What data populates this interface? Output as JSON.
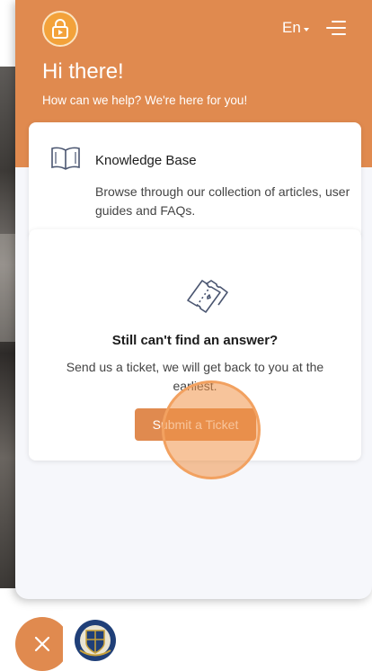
{
  "header": {
    "language": "En",
    "greeting": "Hi there!",
    "subtitle": "How can we help? We're here for you!"
  },
  "knowledge_base": {
    "title": "Knowledge Base",
    "description": "Browse through our collection of articles, user guides and FAQs.",
    "icon": "open-book-icon"
  },
  "ticket": {
    "title": "Still can't find an answer?",
    "description": "Send us a ticket, we will get back to you at the earliest.",
    "button_label": "Submit a Ticket",
    "icon": "ticket-icon"
  },
  "colors": {
    "accent": "#e08a4f",
    "panel_bg": "#f6f7fb",
    "logo_bg": "#f3a23a"
  }
}
